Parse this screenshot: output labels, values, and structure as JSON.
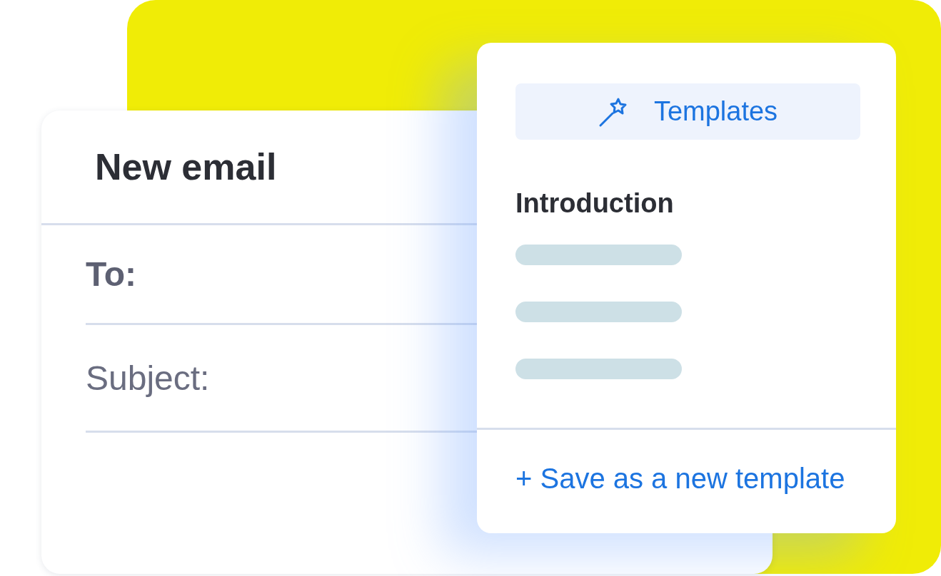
{
  "email": {
    "title": "New email",
    "fields": [
      {
        "label": "To:",
        "kind": "bold"
      },
      {
        "label": "Subject:",
        "kind": "plain"
      }
    ]
  },
  "templates": {
    "button": "Templates",
    "section": "Introduction",
    "save_link": "+ Save as a new template"
  }
}
